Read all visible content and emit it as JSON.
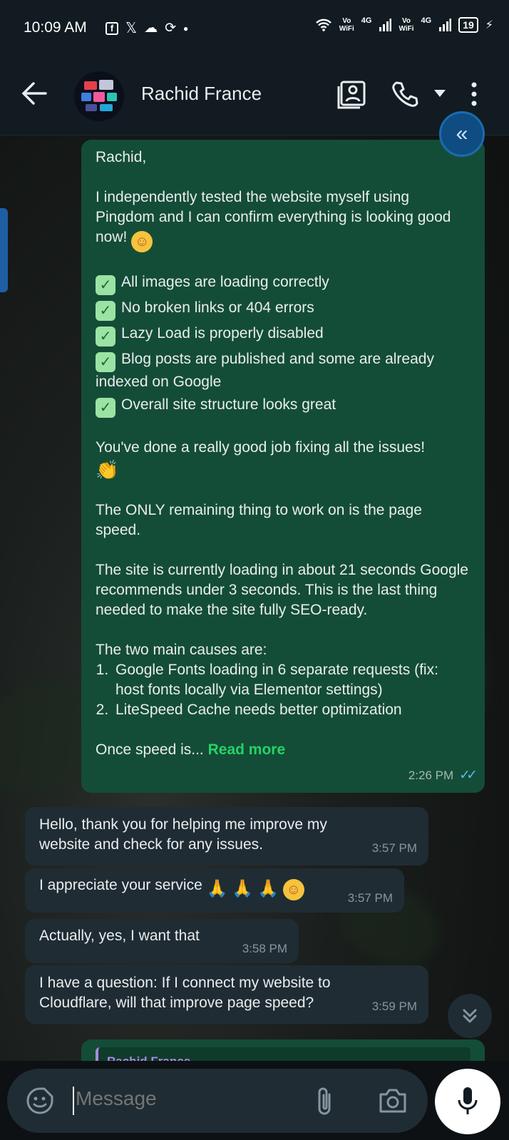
{
  "status_bar": {
    "time": "10:09 AM",
    "left_icons": [
      "facebook-icon",
      "x-icon",
      "cloud-icon",
      "sync-icon",
      "dot"
    ],
    "vowifi_1": "Vo\nWiFi",
    "net_1": "4G",
    "vowifi_2": "Vo\nWiFi",
    "net_2": "4G",
    "battery": "19"
  },
  "header": {
    "contact_name": "Rachid France",
    "icons": [
      "back-arrow-icon",
      "contact-card-icon",
      "phone-icon",
      "chevron-down-icon",
      "more-vert-icon"
    ]
  },
  "messages": [
    {
      "direction": "outgoing",
      "greeting": "Rachid,",
      "para1": "I independently tested the website myself using Pingdom and I can confirm everything is looking good now!",
      "checks": [
        "All images are loading correctly",
        "No broken links or 404 errors",
        "Lazy Load is properly disabled",
        "Blog posts are published and some are already indexed on Google",
        "Overall site structure looks great"
      ],
      "para2": "You've done a really good job fixing all the issues!",
      "para3": "The ONLY remaining thing to work on is the page speed.",
      "para4": "The site is currently loading in about 21 seconds Google recommends under 3 seconds. This is the last thing needed to make the site fully SEO-ready.",
      "causes_title": "The two main causes are:",
      "causes": [
        "Google Fonts loading in 6 separate requests (fix: host fonts locally via Elementor settings)",
        "LiteSpeed Cache needs better optimization"
      ],
      "truncated": "Once speed is...",
      "read_more": "Read more",
      "time": "2:26 PM"
    },
    {
      "direction": "incoming",
      "text": "Hello, thank you for helping me improve my website and check for any issues.",
      "time": "3:57 PM"
    },
    {
      "direction": "incoming",
      "text": "I appreciate your service",
      "time": "3:57 PM"
    },
    {
      "direction": "incoming",
      "text": "Actually, yes, I want that",
      "time": "3:58 PM"
    },
    {
      "direction": "incoming",
      "text": "I have a question: If I connect my website to Cloudflare, will that improve page speed?",
      "time": "3:59 PM"
    },
    {
      "direction": "outgoing",
      "quoted_author": "Rachid France"
    }
  ],
  "composer": {
    "placeholder": "Message"
  },
  "colors": {
    "outgoing_bubble": "#144d37",
    "incoming_bubble": "#202c33",
    "accent_green": "#25d366",
    "read_ticks": "#53bdeb"
  }
}
